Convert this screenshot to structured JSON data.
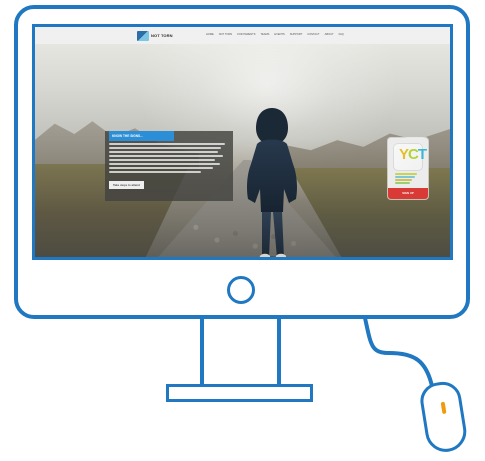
{
  "screen": {
    "nav_logo_text": "NOT\nTORN",
    "nav_items": [
      "HOME",
      "NOT TORN",
      "FOR PARENTS",
      "TEAMS",
      "EVENTS",
      "SUPPORT",
      "CONTACT",
      "ABOUT",
      "FAQ"
    ],
    "hero_card": {
      "title": "KNOW THE SIGNS...",
      "cta_label": "Take steps to attend"
    },
    "badge": {
      "letters": {
        "first": "Y",
        "second": "C",
        "third": "T"
      },
      "button_label": "SIGN UP"
    }
  },
  "colors": {
    "frame": "#1f78c1",
    "accent_blue": "#2c8ed6",
    "badge_red": "#d93a35",
    "mouse_wheel": "#ef9b10"
  },
  "icons": {
    "power": "power-button-icon",
    "mouse": "mouse-icon",
    "person": "person-silhouette-icon"
  }
}
